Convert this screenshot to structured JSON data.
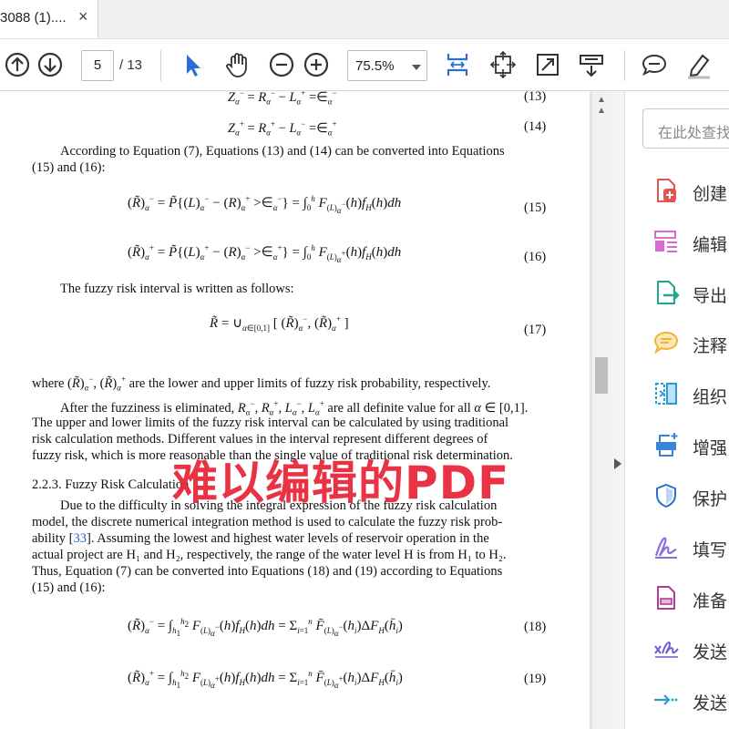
{
  "tab": {
    "title": "3088 (1)....",
    "close_glyph": "×"
  },
  "toolbar": {
    "page_current": "5",
    "page_total": "/ 13",
    "zoom": "75.5%",
    "icons": [
      "prev-page-icon",
      "next-page-icon",
      "select-cursor-icon",
      "hand-tool-icon",
      "zoom-out-icon",
      "zoom-in-icon",
      "fit-page-icon",
      "rotate-icon",
      "full-screen-icon",
      "read-mode-icon",
      "comment-icon",
      "highlight-icon"
    ]
  },
  "document": {
    "eq13": "(13)",
    "eq14": "(14)",
    "eq15": "(15)",
    "eq16": "(16)",
    "eq17": "(17)",
    "eq18": "(18)",
    "eq19": "(19)",
    "p1_line1": "According to Equation (7), Equations (13) and (14) can be converted into Equations",
    "p1_line2": "(15) and (16):",
    "p2": "The fuzzy risk interval is written as follows:",
    "where_pre": "where",
    "where_post": "are the lower and upper limits of fuzzy risk probability, respectively.",
    "p3_line1_a": "After the fuzziness is eliminated,",
    "p3_line1_b": "are all definite value for all",
    "p3_line1_c": "∈ [0,1].",
    "p3_line2": "The upper and lower limits of the fuzzy risk interval can be calculated by using traditional",
    "p3_line3": "risk calculation methods.  Different values in the interval represent different degrees of",
    "p3_line4": "fuzzy risk, which is more reasonable than the single value of traditional risk determination.",
    "section": "2.2.3. Fuzzy Risk Calculation",
    "p4_line1": "Due to the difficulty in solving the integral expression of the fuzzy risk calculation",
    "p4_line2": "model, the discrete numerical integration method is used to calculate the fuzzy risk prob-",
    "p4_line3_a": "ability [",
    "p4_line3_ref": "33",
    "p4_line3_b": "].  Assuming the lowest and highest water levels of reservoir operation in the",
    "p4_line4": "actual project are H₁ and H₂, respectively, the range of the water level H is from H₁ to H₂.",
    "p4_line5": "Thus, Equation (7) can be converted into Equations (18) and (19) according to Equations",
    "p4_line6": "(15) and (16):",
    "watermark": "难以编辑的PDF"
  },
  "side_panel": {
    "search_placeholder": "在此处查找",
    "tools": [
      {
        "label": "创建",
        "icon": "create-pdf-icon",
        "color": "#e0564e"
      },
      {
        "label": "编辑",
        "icon": "edit-pdf-icon",
        "color": "#d86bd0"
      },
      {
        "label": "导出",
        "icon": "export-pdf-icon",
        "color": "#1fa88a"
      },
      {
        "label": "注释",
        "icon": "comment-tool-icon",
        "color": "#f1b330"
      },
      {
        "label": "组织",
        "icon": "organize-pages-icon",
        "color": "#2b9bd8"
      },
      {
        "label": "增强",
        "icon": "enhance-scan-icon",
        "color": "#3a84d8"
      },
      {
        "label": "保护",
        "icon": "protect-icon",
        "color": "#2d6fd0"
      },
      {
        "label": "填写",
        "icon": "fill-sign-icon",
        "color": "#8a6ee0"
      },
      {
        "label": "准备",
        "icon": "prepare-form-icon",
        "color": "#b13c94"
      },
      {
        "label": "发送",
        "icon": "send-for-signature-icon",
        "color": "#6d5fd6"
      },
      {
        "label": "发送",
        "icon": "send-track-icon",
        "color": "#2b9bd8"
      }
    ]
  }
}
